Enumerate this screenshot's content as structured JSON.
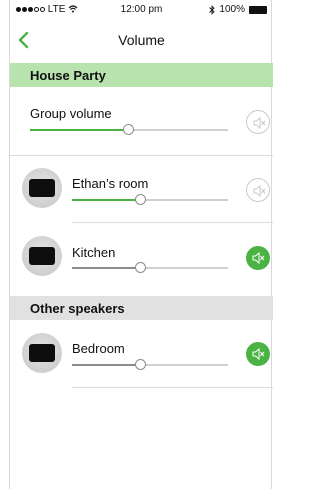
{
  "status_bar": {
    "carrier": "LTE",
    "time": "12:00 pm",
    "battery": "100%"
  },
  "header": {
    "title": "Volume"
  },
  "sections": {
    "party": {
      "label": "House Party"
    },
    "other": {
      "label": "Other speakers"
    }
  },
  "group": {
    "label": "Group volume",
    "level": 0.5,
    "muted": false
  },
  "rooms": [
    {
      "label": "Ethan’s room",
      "level": 0.44,
      "muted": false
    },
    {
      "label": "Kitchen",
      "level": 0.44,
      "muted": true
    },
    {
      "label": "Bedroom",
      "level": 0.44,
      "muted": true
    }
  ],
  "colors": {
    "accent": "#4bb344",
    "section_party_bg": "#b8e2ae",
    "section_other_bg": "#e1e1e1"
  },
  "icons": {
    "back": "chevron-left-icon",
    "mute": "speaker-mute-icon"
  }
}
